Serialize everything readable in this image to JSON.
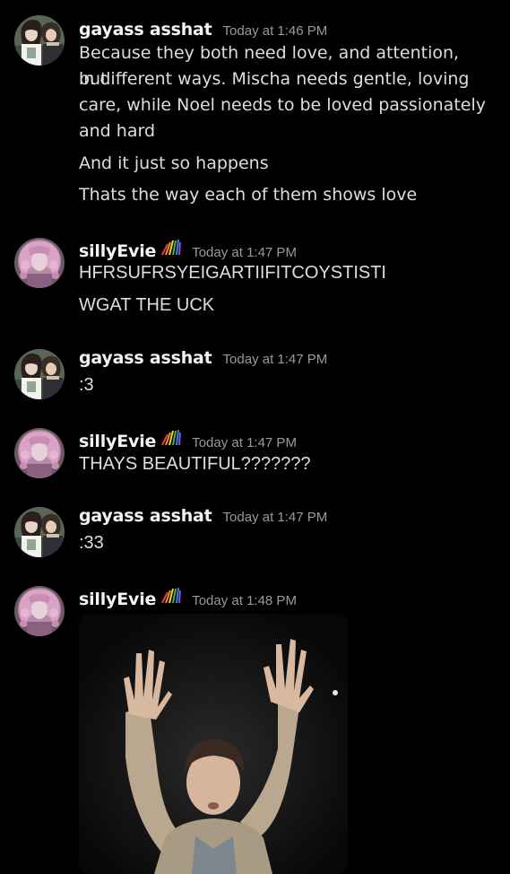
{
  "messages": [
    {
      "author": "gayass asshat",
      "timestamp": "Today at 1:46 PM",
      "avatar": "anime-couple-avatar",
      "lines": [
        "Because they both need love, and attention, but",
        "in different ways. Mischa needs gentle, loving",
        "care, while Noel needs to be loved passionately",
        "and hard",
        "And it just so happens",
        "Thats the way each of them shows love"
      ]
    },
    {
      "author": "sillyEvie",
      "timestamp": "Today at 1:47 PM",
      "avatar": "pink-character-avatar",
      "badge": "rainbow-stripes-badge",
      "lines": [
        "HFRSUFRSYEIGARTIIFITCOYSTISTI",
        "WGAT THE UCK"
      ]
    },
    {
      "author": "gayass asshat",
      "timestamp": "Today at 1:47 PM",
      "avatar": "anime-couple-avatar",
      "lines": [
        ":3"
      ]
    },
    {
      "author": "sillyEvie",
      "timestamp": "Today at 1:47 PM",
      "avatar": "pink-character-avatar",
      "badge": "rainbow-stripes-badge",
      "lines": [
        "THAYS BEAUTIFUL???????"
      ]
    },
    {
      "author": "gayass asshat",
      "timestamp": "Today at 1:47 PM",
      "avatar": "anime-couple-avatar",
      "lines": [
        ":33"
      ]
    },
    {
      "author": "sillyEvie",
      "timestamp": "Today at 1:48 PM",
      "avatar": "pink-character-avatar",
      "badge": "rainbow-stripes-badge",
      "attachment": "image-attachment-person-raising-hands"
    }
  ],
  "colors": {
    "background": "#000000",
    "username": "#f2f3f5",
    "timestamp": "#949ba4",
    "text": "#dbdee1"
  }
}
